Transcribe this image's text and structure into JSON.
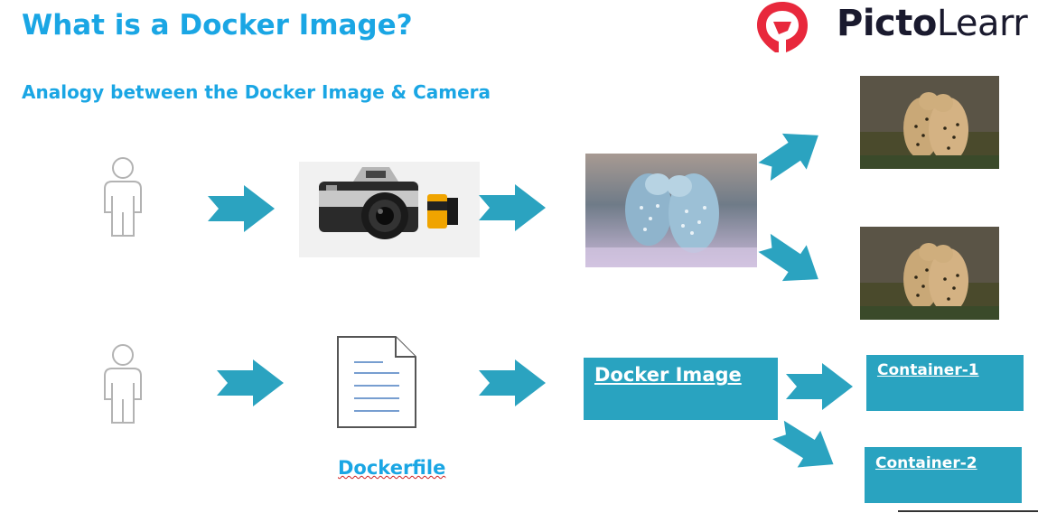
{
  "slide": {
    "title": "What is a Docker Image?",
    "subtitle": "Analogy between the Docker Image & Camera"
  },
  "logo": {
    "text_bold": "Picto",
    "text_regular": "Learr",
    "mark_color": "#e8283c"
  },
  "diagram": {
    "dockerfile_label": "Dockerfile",
    "docker_image_label": "Docker Image",
    "container1_label": "Container-1",
    "container2_label": "Container-2"
  },
  "colors": {
    "title": "#1aa6e4",
    "arrow": "#2ba3c0",
    "box": "#29a3c0"
  },
  "icons": [
    "person-icon",
    "camera-image",
    "negative-film-image",
    "cheetah-photo-image",
    "document-icon",
    "arrow-icon"
  ]
}
